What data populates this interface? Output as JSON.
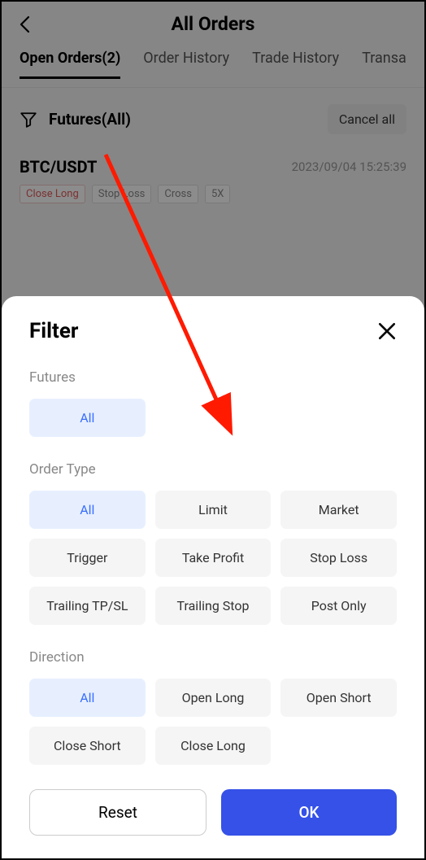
{
  "header": {
    "title": "All Orders"
  },
  "tabs": [
    "Open Orders(2)",
    "Order History",
    "Trade History",
    "Transa"
  ],
  "activeTab": 0,
  "filterRow": {
    "label": "Futures(All)",
    "cancel": "Cancel all"
  },
  "order": {
    "pair": "BTC/USDT",
    "time": "2023/09/04 15:25:39",
    "tags": [
      "Close Long",
      "Stop Loss",
      "Cross",
      "5X"
    ]
  },
  "sheet": {
    "title": "Filter",
    "sections": {
      "futures": {
        "label": "Futures",
        "options": [
          "All"
        ],
        "selected": 0
      },
      "orderType": {
        "label": "Order Type",
        "options": [
          "All",
          "Limit",
          "Market",
          "Trigger",
          "Take Profit",
          "Stop Loss",
          "Trailing TP/SL",
          "Trailing Stop",
          "Post Only"
        ],
        "selected": 0
      },
      "direction": {
        "label": "Direction",
        "options": [
          "All",
          "Open Long",
          "Open Short",
          "Close Short",
          "Close Long"
        ],
        "selected": 0
      }
    },
    "reset": "Reset",
    "ok": "OK"
  }
}
